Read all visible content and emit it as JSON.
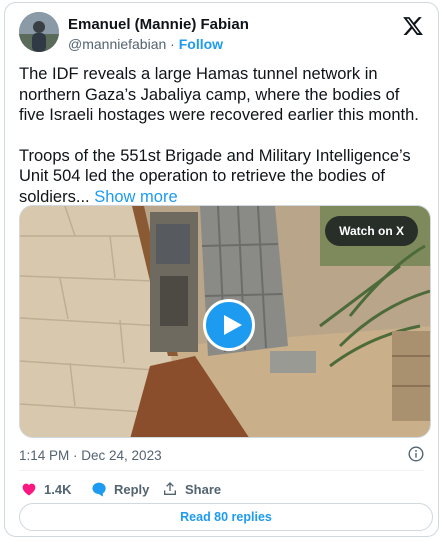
{
  "author": {
    "name": "Emanuel (Mannie) Fabian",
    "handle": "@manniefabian",
    "separator": "·",
    "follow_label": "Follow"
  },
  "tweet": {
    "paragraphs": [
      "The IDF reveals a large Hamas tunnel network in northern Gaza’s Jabaliya camp, where the bodies of five Israeli hostages were recovered earlier this month.",
      "Troops of the 551st Brigade and Military Intelligence’s Unit 504 led the operation to retrieve the bodies of soldiers..."
    ],
    "show_more_label": "Show more"
  },
  "media": {
    "watch_label": "Watch on X",
    "play_icon": "play-icon"
  },
  "meta": {
    "timestamp": "1:14 PM · Dec 24, 2023",
    "info_icon": "info-icon"
  },
  "actions": {
    "like_count": "1.4K",
    "reply_label": "Reply",
    "share_label": "Share"
  },
  "read_replies_label": "Read 80 replies",
  "colors": {
    "accent": "#1d9bf0",
    "like": "#f91880",
    "secondary_text": "#536471",
    "border": "#cfd9de"
  }
}
